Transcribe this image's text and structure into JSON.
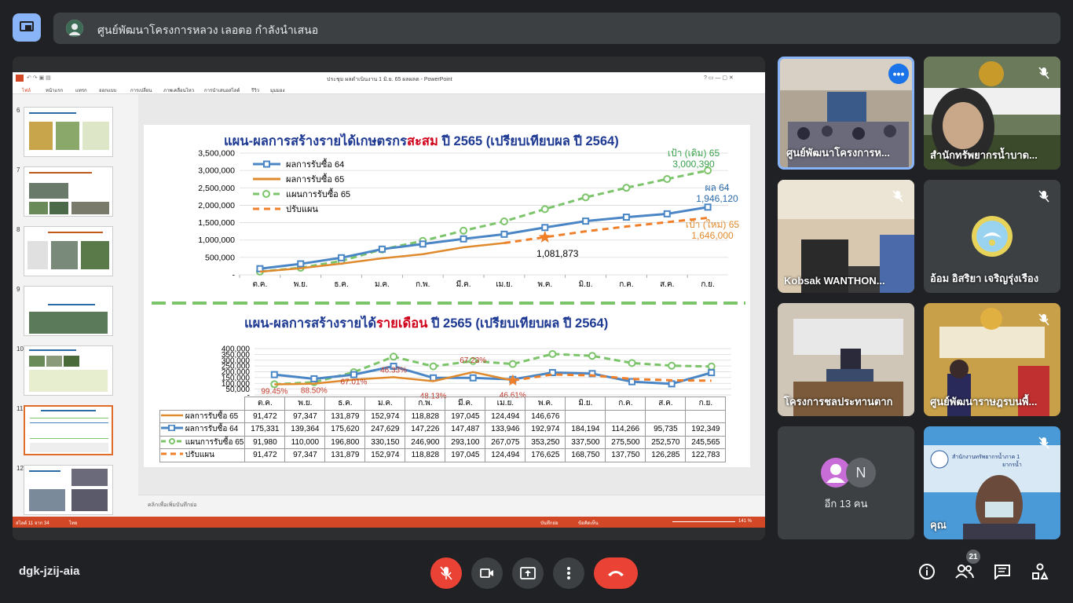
{
  "header": {
    "presenter_title": "ศูนย์พัฒนาโครงการหลวง เลอตอ กำลังนำเสนอ"
  },
  "powerpoint": {
    "window_title": "ประชุม ผลดำเนินงาน 1 มิ.ย. 65 ผลผลต - PowerPoint",
    "tabs": [
      "ไฟล์",
      "หน้าแรก",
      "แทรก",
      "ออกแบบ",
      "การเปลี่ยน",
      "ภาพเคลื่อนไหว",
      "การนำเสนอสไลด์",
      "รีวิว",
      "มุมมอง"
    ],
    "thumbnail_numbers": [
      "6",
      "7",
      "8",
      "9",
      "10",
      "11",
      "12"
    ],
    "notes_placeholder": "คลิกเพื่อเพิ่มบันทึกย่อ",
    "status_slide": "สไลด์ 11 จาก 34",
    "status_lang": "ไทย",
    "status_notes": "บันทึกย่อ",
    "status_comments": "ข้อคิดเห็น",
    "status_zoom": "141 %"
  },
  "chart_data": [
    {
      "type": "line",
      "title_part1": "แผน-ผลการสร้างรายได้เกษตรกร",
      "title_part2": "สะสม",
      "title_part3": " ปี 2565 (เปรียบเทียบผล ปี 2564)",
      "categories": [
        "ต.ค.",
        "พ.ย.",
        "ธ.ค.",
        "ม.ค.",
        "ก.พ.",
        "มี.ค.",
        "เม.ย.",
        "พ.ค.",
        "มิ.ย.",
        "ก.ค.",
        "ส.ค.",
        "ก.ย."
      ],
      "ylim": [
        0,
        3500000
      ],
      "yticks": [
        "3,500,000",
        "3,000,000",
        "2,500,000",
        "2,000,000",
        "1,500,000",
        "1,000,000",
        "500,000",
        "-"
      ],
      "series": [
        {
          "name": "ผลการรับซื้อ 64",
          "color": "#4a86c5",
          "values": [
            175331,
            314695,
            490315,
            737944,
            885170,
            1032657,
            1166603,
            1359577,
            1543761,
            1658027,
            1753762,
            1946120
          ]
        },
        {
          "name": "ผลการรับซื้อ 65",
          "color": "#e08a2e",
          "values": [
            91472,
            188819,
            320698,
            473672,
            592500,
            789545,
            914039,
            null,
            null,
            null,
            null,
            null
          ]
        },
        {
          "name": "แผนการรับซื้อ 65",
          "color": "#7cc46a",
          "values": [
            91980,
            201980,
            398780,
            729130,
            976030,
            1269130,
            1536205,
            1889455,
            2226955,
            2502455,
            2755025,
            3000390
          ]
        },
        {
          "name": "ปรับแผน",
          "color": "#f07f2a",
          "values": [
            null,
            null,
            null,
            null,
            null,
            null,
            914039,
            1081873,
            1250623,
            1388373,
            1514658,
            1637441
          ]
        }
      ],
      "annotations": {
        "plan_old_label": "เป้า (เดิม) 65",
        "plan_old_value": "3,000,390",
        "result64_label": "ผล 64",
        "result64_value": "1,946,120",
        "plan_new_label": "เป้า (ใหม่) 65",
        "plan_new_value": "1,646,000",
        "may_value": "1,081,873"
      }
    },
    {
      "type": "line",
      "title_part1": "แผน-ผลการสร้างรายได้",
      "title_part2": "รายเดือน",
      "title_part3": " ปี 2565 (เปรียบเทียบผล ปี 2564)",
      "categories": [
        "ต.ค.",
        "พ.ย.",
        "ธ.ค.",
        "ม.ค.",
        "ก.พ.",
        "มี.ค.",
        "เม.ย.",
        "พ.ค.",
        "มิ.ย.",
        "ก.ค.",
        "ส.ค.",
        "ก.ย."
      ],
      "ylim": [
        0,
        400000
      ],
      "yticks": [
        "400,000",
        "350,000",
        "300,000",
        "250,000",
        "200,000",
        "150,000",
        "100,000",
        "50,000",
        "-"
      ],
      "percent_labels": [
        "99.45%",
        "88.50%",
        "67.01%",
        "46.33%",
        "48.13%",
        "67.23%",
        "46.61%"
      ],
      "series": [
        {
          "name": "ผลการรับซื้อ 65",
          "color": "#e08a2e",
          "values": [
            91472,
            97347,
            131879,
            152974,
            118828,
            197045,
            124494,
            null,
            null,
            null,
            null,
            null
          ]
        },
        {
          "name": "ผลการรับซื้อ 64",
          "color": "#4a86c5",
          "values": [
            175331,
            139364,
            175620,
            247629,
            147226,
            147487,
            133946,
            192974,
            184194,
            114266,
            95735,
            192349
          ]
        },
        {
          "name": "แผนการรับซื้อ 65",
          "color": "#7cc46a",
          "values": [
            91980,
            110000,
            196800,
            330150,
            246900,
            293100,
            267075,
            353250,
            337500,
            275500,
            252570,
            245565
          ]
        },
        {
          "name": "ปรับแผน",
          "color": "#f07f2a",
          "values": [
            null,
            null,
            null,
            null,
            null,
            null,
            124494,
            176625,
            168750,
            137750,
            126285,
            122783
          ]
        }
      ],
      "table": {
        "headers": [
          "ต.ค.",
          "พ.ย.",
          "ธ.ค.",
          "ม.ค.",
          "ก.พ.",
          "มี.ค.",
          "เม.ย.",
          "พ.ค.",
          "มิ.ย.",
          "ก.ค.",
          "ส.ค.",
          "ก.ย."
        ],
        "rows": [
          {
            "label": "ผลการรับซื้อ 65",
            "cells": [
              "91,472",
              "97,347",
              "131,879",
              "152,974",
              "118,828",
              "197,045",
              "124,494",
              "146,676",
              "",
              "",
              "",
              ""
            ]
          },
          {
            "label": "ผลการรับซื้อ 64",
            "cells": [
              "175,331",
              "139,364",
              "175,620",
              "247,629",
              "147,226",
              "147,487",
              "133,946",
              "192,974",
              "184,194",
              "114,266",
              "95,735",
              "192,349"
            ]
          },
          {
            "label": "แผนการรับซื้อ 65",
            "cells": [
              "91,980",
              "110,000",
              "196,800",
              "330,150",
              "246,900",
              "293,100",
              "267,075",
              "353,250",
              "337,500",
              "275,500",
              "252,570",
              "245,565"
            ]
          },
          {
            "label": "ปรับแผน",
            "cells": [
              "91,472",
              "97,347",
              "131,879",
              "152,974",
              "118,828",
              "197,045",
              "124,494",
              "176,625",
              "168,750",
              "137,750",
              "126,285",
              "122,783"
            ]
          }
        ]
      }
    }
  ],
  "participants": [
    {
      "name": "ศูนย์พัฒนาโครงการห...",
      "mic_muted": false,
      "has_more": true
    },
    {
      "name": "สำนักทรัพยากรน้ำบาด...",
      "mic_muted": true
    },
    {
      "name": "Kobsak WANTHON...",
      "mic_muted": true
    },
    {
      "name": "อ้อม อิสริยา เจริญรุ่งเรือง",
      "mic_muted": true
    },
    {
      "name": "โครงการชลประทานตาก",
      "mic_muted": false
    },
    {
      "name": "ศูนย์พัฒนาราษฎรบนพื้...",
      "mic_muted": true
    },
    {
      "name": "อีก 13 คน",
      "avatar_letter": "N"
    },
    {
      "name": "คุณ",
      "mic_muted": true,
      "video_text": "สำนักงานทรัพยากรน้ำภาค 1",
      "video_text2": "ยากรน้ำ"
    }
  ],
  "bottom": {
    "meeting_code": "dgk-jzij-aia",
    "people_count": "21"
  },
  "colors": {
    "background": "#202124",
    "tile": "#3c4043",
    "end_call": "#ea4335",
    "accent": "#8ab4f8"
  }
}
